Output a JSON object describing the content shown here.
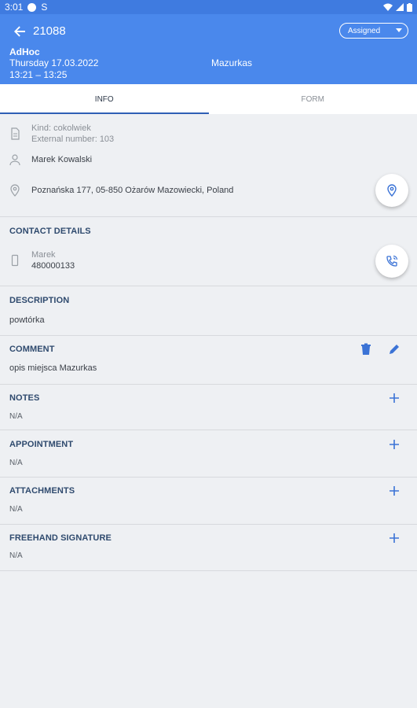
{
  "status_bar": {
    "time": "3:01",
    "extra_icon": "S"
  },
  "header": {
    "order_id": "21088",
    "status_value": "Assigned",
    "type_label": "AdHoc",
    "date": "Thursday 17.03.2022",
    "time_range": "13:21 – 13:25",
    "location_name": "Mazurkas"
  },
  "tabs": [
    {
      "label": "INFO"
    },
    {
      "label": "FORM"
    }
  ],
  "info": {
    "kind": "Kind: cokolwiek",
    "external_number": "External number: 103",
    "person": "Marek Kowalski",
    "address": "Poznańska 177, 05-850 Ożarów Mazowiecki, Poland"
  },
  "contact": {
    "title": "CONTACT DETAILS",
    "name": "Marek",
    "phone": "480000133"
  },
  "description": {
    "title": "DESCRIPTION",
    "text": "powtórka"
  },
  "comment": {
    "title": "COMMENT",
    "text": "opis miejsca Mazurkas"
  },
  "notes": {
    "title": "NOTES",
    "value": "N/A"
  },
  "appointment": {
    "title": "APPOINTMENT",
    "value": "N/A"
  },
  "attachments": {
    "title": "ATTACHMENTS",
    "value": "N/A"
  },
  "signature": {
    "title": "FREEHAND SIGNATURE",
    "value": "N/A"
  },
  "colors": {
    "primary": "#4a88ec",
    "statusbar": "#3f7be0",
    "accent": "#3b73d6",
    "background": "#eef0f3"
  }
}
